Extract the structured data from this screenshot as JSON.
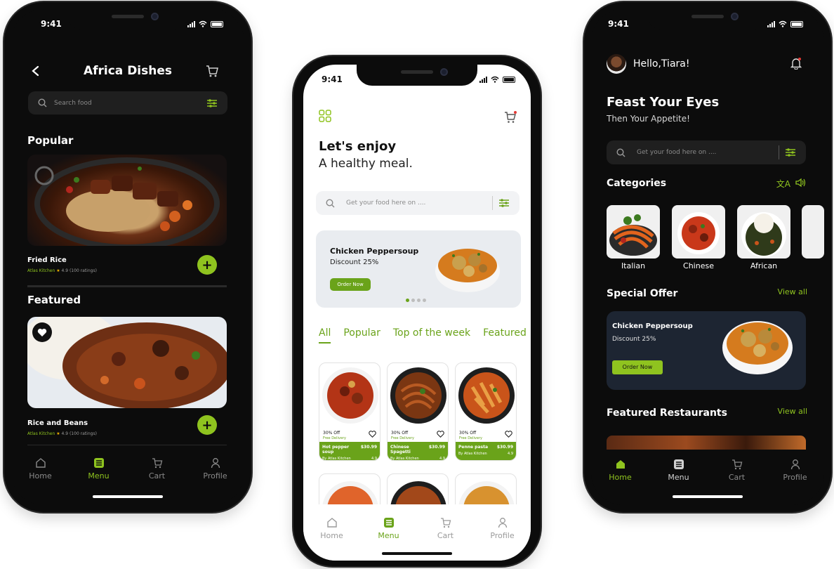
{
  "colors": {
    "accent": "#8fc31f",
    "dark_bg": "#0c0c0c",
    "dark_surface": "#1f1f1f",
    "light_bg": "#ffffff"
  },
  "left": {
    "time": "9:41",
    "title": "Africa Dishes",
    "search_placeholder": "Search food",
    "section_popular": "Popular",
    "section_featured": "Featured",
    "items": [
      {
        "name": "Fried Rice",
        "vendor": "Atlas Kitchen",
        "rating": "4.9 (100 ratings)"
      },
      {
        "name": "Rice and Beans",
        "vendor": "Atlas Kitchen",
        "rating": "4.9 (100 ratings)"
      }
    ],
    "tabs": [
      "Home",
      "Menu",
      "Cart",
      "Profile"
    ]
  },
  "middle": {
    "time": "9:41",
    "headline": "Let's enjoy",
    "subheadline": "A healthy meal.",
    "search_placeholder": "Get your food here on ....",
    "promo_title": "Chicken Peppersoup",
    "promo_discount": "Discount 25%",
    "promo_button": "Order Now",
    "filters": [
      "All",
      "Popular",
      "Top of the week",
      "Featured"
    ],
    "cards": [
      {
        "offer": "30% Off",
        "delivery": "Free Delivery",
        "name": "Hot pepper soup",
        "price": "$30.99",
        "vendor": "By Atlas Kitchen",
        "rating": "4.9"
      },
      {
        "offer": "30% Off",
        "delivery": "Free Delivery",
        "name": "Chinese Spagetti",
        "price": "$30.99",
        "vendor": "By Atlas Kitchen",
        "rating": "4.9"
      },
      {
        "offer": "30% Off",
        "delivery": "Free Delivery",
        "name": "Penne pasta",
        "price": "$30.99",
        "vendor": "By Atlas Kitchen",
        "rating": "4.9"
      }
    ],
    "tabs": [
      "Home",
      "Menu",
      "Cart",
      "Profile"
    ]
  },
  "right": {
    "time": "9:41",
    "greeting": "Hello,Tiara!",
    "headline": "Feast Your Eyes",
    "subheadline": "Then Your Appetite!",
    "search_placeholder": "Get your food here on ....",
    "categories_title": "Categories",
    "categories": [
      "Italian",
      "Chinese",
      "African"
    ],
    "special_offer_title": "Special Offer",
    "view_all": "View all",
    "offer_title": "Chicken Peppersoup",
    "offer_discount": "Discount 25%",
    "offer_button": "Order Now",
    "featured_title": "Featured Restaurants",
    "view_all_2": "View all",
    "tabs": [
      "Home",
      "Menu",
      "Cart",
      "Profile"
    ]
  }
}
